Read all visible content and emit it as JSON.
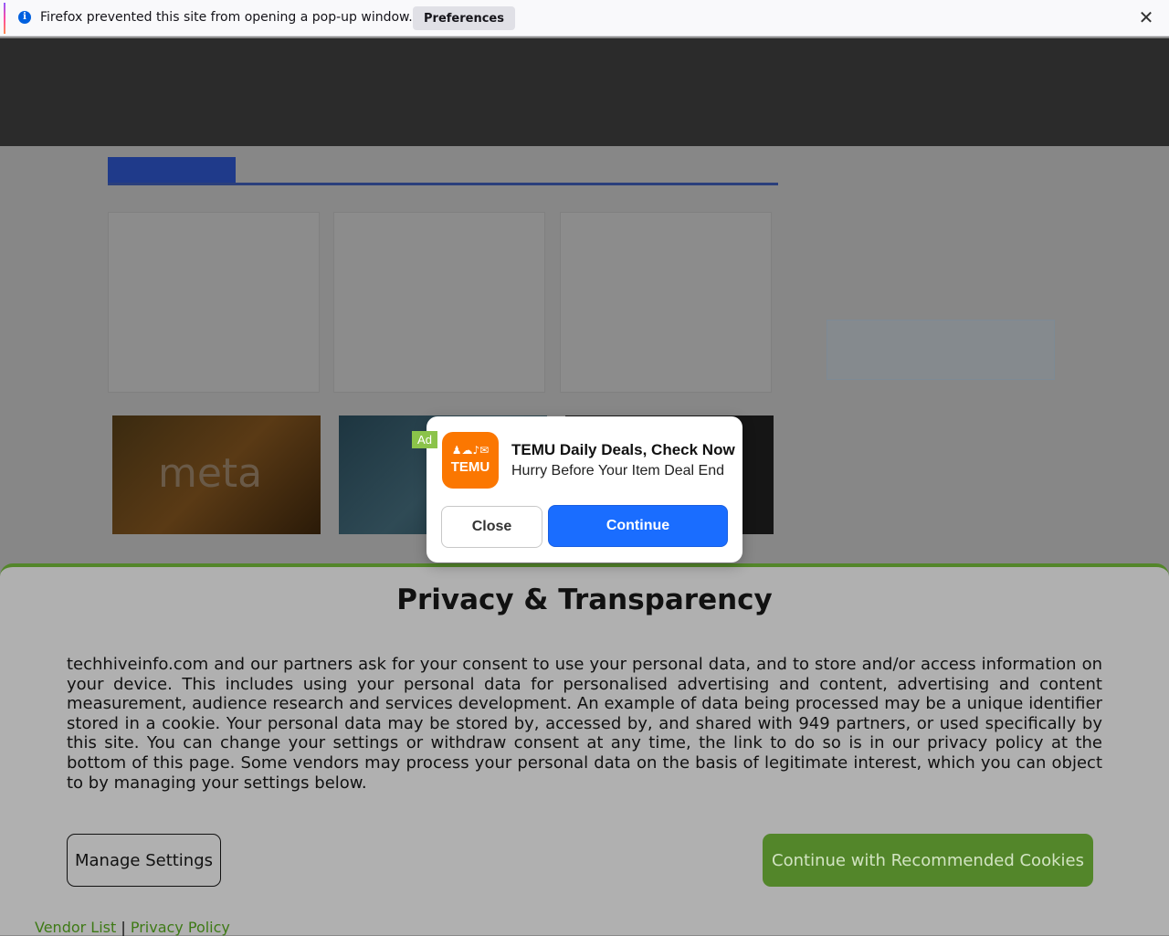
{
  "notification": {
    "info_glyph": "i",
    "message": "Firefox prevented this site from opening a pop-up window.",
    "preferences_label": "Preferences",
    "close_glyph": "✕"
  },
  "ad": {
    "badge": "Ad",
    "brand": "TEMU",
    "logo_glyphs": "♟☁♪✉",
    "title": "TEMU Daily Deals, Check Now",
    "subtitle": "Hurry Before Your Item Deal End",
    "close_label": "Close",
    "continue_label": "Continue",
    "colors": {
      "brand": "#fb7701",
      "continue": "#1a6dff"
    }
  },
  "background": {
    "thumb_text": "meta"
  },
  "consent": {
    "title": "Privacy & Transparency",
    "body": "techhiveinfo.com and our partners ask for your consent to use your personal data, and to store and/or access information on your device. This includes using your personal data for personalised advertising and content, advertising and content measurement, audience research and services development. An example of data being processed may be a unique identifier stored in a cookie. Your personal data may be stored by, accessed by, and shared with 949 partners, or used specifically by this site. You can change your settings or withdraw consent at any time, the link to do so is in our privacy policy at the bottom of this page. Some vendors may process your personal data on the basis of legitimate interest, which you can object to by managing your settings below.",
    "manage_label": "Manage Settings",
    "accept_label": "Continue with Recommended Cookies",
    "vendor_link": "Vendor List",
    "separator": "|",
    "privacy_link": "Privacy Policy",
    "colors": {
      "accent": "#53862a"
    }
  }
}
